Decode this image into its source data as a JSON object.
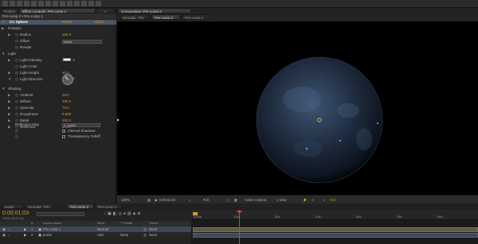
{
  "project_tab": "Project",
  "effect_controls_tab": "Effect Controls: Pre-comp 1",
  "composition_tab": "Composition: Pre-comp 2",
  "effect_breadcrumb": "Pre-comp 2 • Pre-comp 1",
  "effect": {
    "name": "CC Sphere",
    "reset": "Reset",
    "about": "About...",
    "props": [
      {
        "label": "Rotation",
        "value": "",
        "indent": 1,
        "twirl": "▶"
      },
      {
        "label": "Radius",
        "value": "288.0",
        "indent": 2,
        "twirl": "▶"
      },
      {
        "label": "Offset",
        "value": "640.0,360.0",
        "indent": 2,
        "twirl": ""
      },
      {
        "label": "Render",
        "value": "",
        "indent": 2,
        "twirl": ""
      },
      {
        "label": "Light",
        "value": "",
        "indent": 1,
        "twirl": "▼"
      },
      {
        "label": "Light Intensity",
        "value": "21.0",
        "indent": 2,
        "twirl": "▶"
      },
      {
        "label": "Light Color",
        "value": "",
        "indent": 2,
        "twirl": ""
      },
      {
        "label": "Light Height",
        "value": "40.0",
        "indent": 2,
        "twirl": "▶"
      },
      {
        "label": "Light Direction",
        "value": "0x-38.0°",
        "indent": 2,
        "twirl": "▼"
      }
    ],
    "render_value": "Inside",
    "shading": [
      {
        "label": "Shading",
        "value": "",
        "indent": 1,
        "twirl": "▼"
      },
      {
        "label": "Ambient",
        "value": "29.0",
        "indent": 2,
        "twirl": "▶"
      },
      {
        "label": "Diffuse",
        "value": "100.0",
        "indent": 2,
        "twirl": "▶"
      },
      {
        "label": "Specular",
        "value": "75.0",
        "indent": 2,
        "twirl": "▶"
      },
      {
        "label": "Roughness",
        "value": "0.000",
        "indent": 2,
        "twirl": "▶"
      },
      {
        "label": "Metal",
        "value": "100.0",
        "indent": 2,
        "twirl": "▶"
      },
      {
        "label": "Reflective",
        "value": "100.0",
        "indent": 2,
        "twirl": "▶"
      }
    ],
    "reflection_map_label": "Reflection Map",
    "reflection_map_value": "2. probe",
    "internal_shadows": "Internal Shadows",
    "transparency_falloff": "Transparency Falloff"
  },
  "comp_tabs": [
    "Smudge_TOI",
    "Pre-comp 2",
    "Pre-comp 1"
  ],
  "viewer_bar": {
    "zoom": "100%",
    "timecode": "0:00:01:03",
    "resolution": "Full",
    "camera": "Active Camera",
    "views": "1 View",
    "exposure": "+0.0"
  },
  "timeline_tabs": [
    "probe",
    "Smudge_TOI",
    "Pre-comp 2",
    "Pre-comp 1"
  ],
  "timeline_time": "0:00:01:03",
  "timeline_frame": "00028 (25.00 fps)",
  "timeline_headers": [
    "#",
    "Source Name",
    "Mode",
    "T TrkMat",
    "Parent"
  ],
  "layers": [
    {
      "num": "1",
      "name": "Pre-comp 1",
      "mode": "Normal",
      "trkmat": "",
      "parent": "None"
    },
    {
      "num": "2",
      "name": "probe",
      "mode": "Add",
      "trkmat": "None",
      "parent": "None"
    }
  ],
  "ruler": [
    "0:00s",
    "01s",
    "02s",
    "03s",
    "04s",
    "05s",
    "06s"
  ],
  "colors": {
    "value_orange": "#d49b22",
    "layer_bar": "#5f5a44",
    "playhead": "#e23b2a",
    "selection": "#4a5666"
  }
}
